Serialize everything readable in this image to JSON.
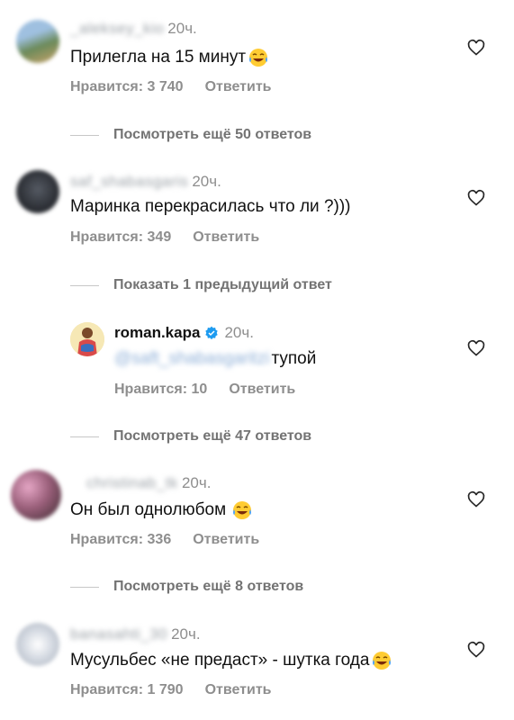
{
  "comments": [
    {
      "username": "_aleksey_kio",
      "time": "20ч.",
      "text": "Прилегла на 15 минут",
      "likes": "Нравится: 3 740",
      "reply": "Ответить",
      "avatar_color": "#6b8a5a",
      "has_emoji": true
    },
    {
      "username": "saf_shabasgaris",
      "time": "20ч.",
      "text": "Маринка перекрасилась что ли ?)))",
      "likes": "Нравится: 349",
      "reply": "Ответить",
      "avatar_color": "#3a3d44"
    },
    {
      "username": "roman.kapa",
      "time": "20ч.",
      "mention": "@saft_shabasgaritzi",
      "text": "тупой",
      "likes": "Нравится: 10",
      "reply": "Ответить",
      "avatar_color": "#f2c94c"
    },
    {
      "username": "christinab_tk",
      "time": "20ч.",
      "text": "Он был однолюбом",
      "likes": "Нравится: 336",
      "reply": "Ответить",
      "avatar_color": "#c58aa8",
      "has_emoji": true
    },
    {
      "username": "banasahti_30",
      "time": "20ч.",
      "text": "Мусульбес «не предаст» - шутка года",
      "likes": "Нравится: 1 790",
      "reply": "Ответить",
      "avatar_color": "#b8bfca",
      "has_emoji": true
    }
  ],
  "threads": [
    "Посмотреть ещё 50 ответов",
    "Показать 1 предыдущий ответ",
    "Посмотреть ещё 47 ответов",
    "Посмотреть ещё 8 ответов"
  ],
  "colors": {
    "secondary": "#8e8e8e",
    "verified": "#1d9bf0",
    "divider": "#c7c7c7"
  }
}
